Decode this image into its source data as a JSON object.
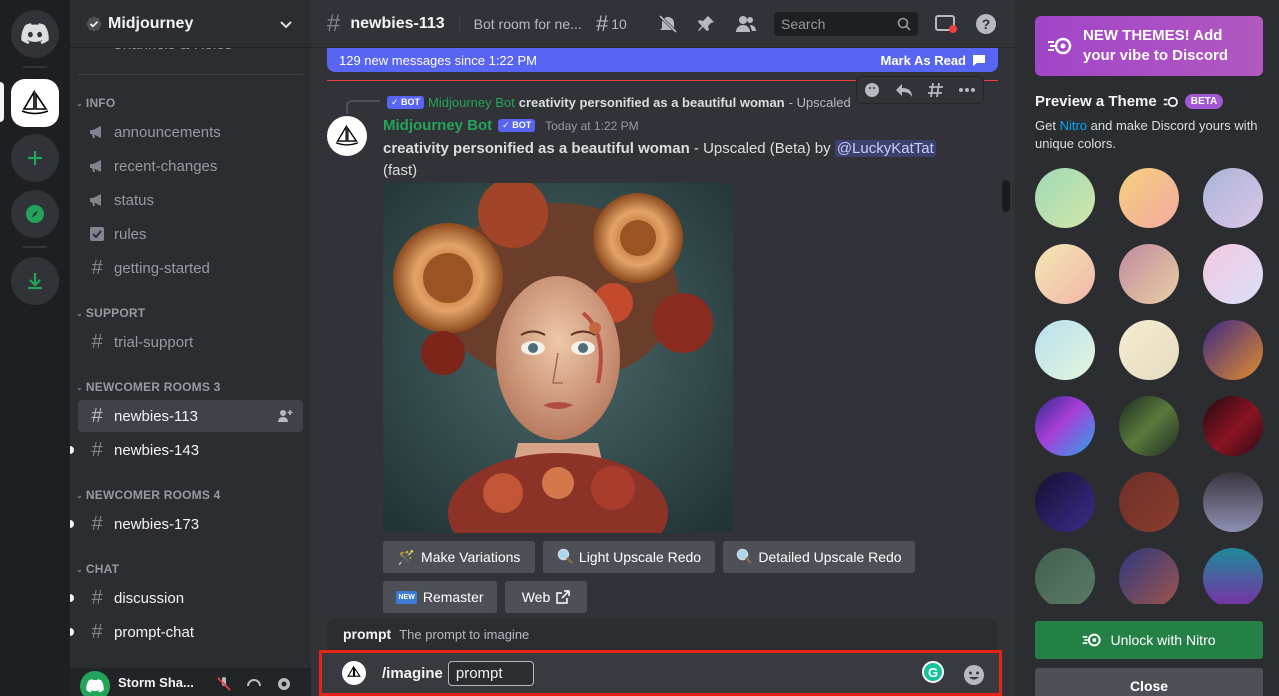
{
  "guild": {
    "name": "Midjourney",
    "scrolled_partial": "Channels & Roles"
  },
  "sidebar": {
    "categories": {
      "info": "INFO",
      "support": "SUPPORT",
      "newcomer3": "NEWCOMER ROOMS 3",
      "newcomer4": "NEWCOMER ROOMS 4",
      "chat": "CHAT"
    },
    "channels": {
      "announcements": "announcements",
      "recent_changes": "recent-changes",
      "status": "status",
      "rules": "rules",
      "getting_started": "getting-started",
      "trial_support": "trial-support",
      "newbies_113": "newbies-113",
      "newbies_143": "newbies-143",
      "newbies_173": "newbies-173",
      "discussion": "discussion",
      "prompt_chat": "prompt-chat"
    }
  },
  "user": {
    "name": "Storm Sha..."
  },
  "topbar": {
    "channel": "newbies-113",
    "topic": "Bot room for ne...",
    "threads_count": "10",
    "search_placeholder": "Search"
  },
  "chat": {
    "new_messages": "129 new messages since 1:22 PM",
    "mark_as_read": "Mark As Read",
    "reply": {
      "bot_tag": "BOT",
      "author": "Midjourney Bot",
      "prompt": "creativity personified as a beautiful woman",
      "rest": " - Upscaled by @L"
    },
    "message": {
      "author": "Midjourney Bot",
      "bot_tag": "BOT",
      "timestamp": "Today at 1:22 PM",
      "prompt": "creativity personified as a beautiful woman",
      "suffix": " - Upscaled (Beta) by ",
      "mention": "@LuckyKatTat",
      "mode": "(fast)"
    },
    "buttons": {
      "make_variations": "Make Variations",
      "light_upscale_redo": "Light Upscale Redo",
      "detailed_upscale_redo": "Detailed Upscale Redo",
      "remaster": "Remaster",
      "web": "Web",
      "new_badge": "NEW"
    }
  },
  "composer": {
    "option_name": "prompt",
    "option_desc": "The prompt to imagine",
    "command": "/imagine",
    "param": "prompt"
  },
  "theme_panel": {
    "banner": "NEW THEMES! Add your vibe to Discord",
    "title": "Preview a Theme",
    "beta": "BETA",
    "desc_prefix": "Get ",
    "nitro": "Nitro",
    "desc_suffix": " and make Discord yours with unique colors.",
    "unlock": "Unlock with Nitro",
    "close": "Close"
  },
  "colors": {
    "blurple": "#5865f2",
    "green": "#248046",
    "composer_highlight": "#e52416"
  }
}
